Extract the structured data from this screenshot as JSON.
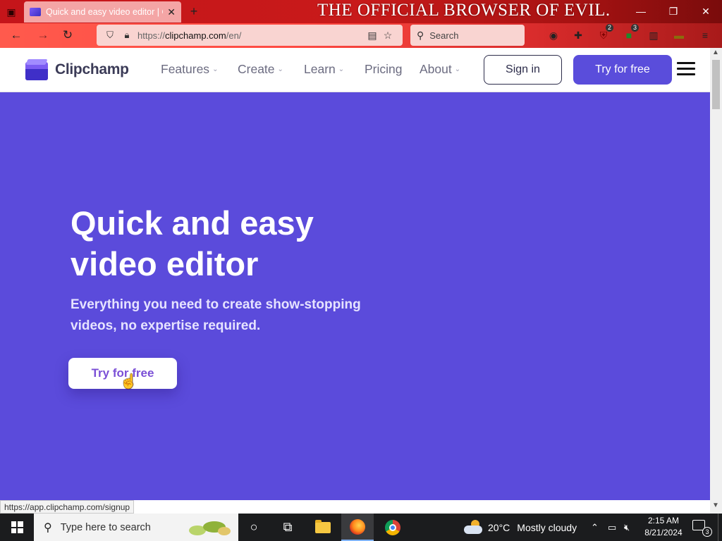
{
  "browser": {
    "tab_title": "Quick and easy video editor | Cli",
    "banner": "THE OFFICIAL BROWSER OF EVIL.",
    "url_prefix": "https://",
    "url_host": "clipchamp.com",
    "url_path": "/en/",
    "search_placeholder": "Search",
    "extension_badges": [
      "2",
      "3"
    ],
    "status_url": "https://app.clipchamp.com/signup",
    "window_controls": [
      "minimize",
      "restore",
      "close"
    ]
  },
  "site": {
    "brand": "Clipchamp",
    "nav": [
      {
        "label": "Features",
        "has_dropdown": true
      },
      {
        "label": "Create",
        "has_dropdown": true
      },
      {
        "label": "Learn",
        "has_dropdown": true
      },
      {
        "label": "Pricing",
        "has_dropdown": false
      },
      {
        "label": "About",
        "has_dropdown": true
      }
    ],
    "sign_in": "Sign in",
    "try_free_top": "Try for free",
    "hero": {
      "title_line1": "Quick and easy",
      "title_line2": "video editor",
      "subtitle": "Everything you need to create show-stopping videos, no expertise required.",
      "cta": "Try for free"
    },
    "colors": {
      "hero_bg": "#5b4bdb",
      "primary_button": "#5a4ddb",
      "cta_text": "#7a4fd6"
    }
  },
  "taskbar": {
    "search_placeholder": "Type here to search",
    "weather_temp": "20°C",
    "weather_desc": "Mostly cloudy",
    "time": "2:15 AM",
    "date": "8/21/2024",
    "notification_count": "3",
    "pinned": [
      "cortana-icon",
      "task-view-icon",
      "file-explorer-icon",
      "firefox-icon",
      "chrome-icon"
    ]
  }
}
